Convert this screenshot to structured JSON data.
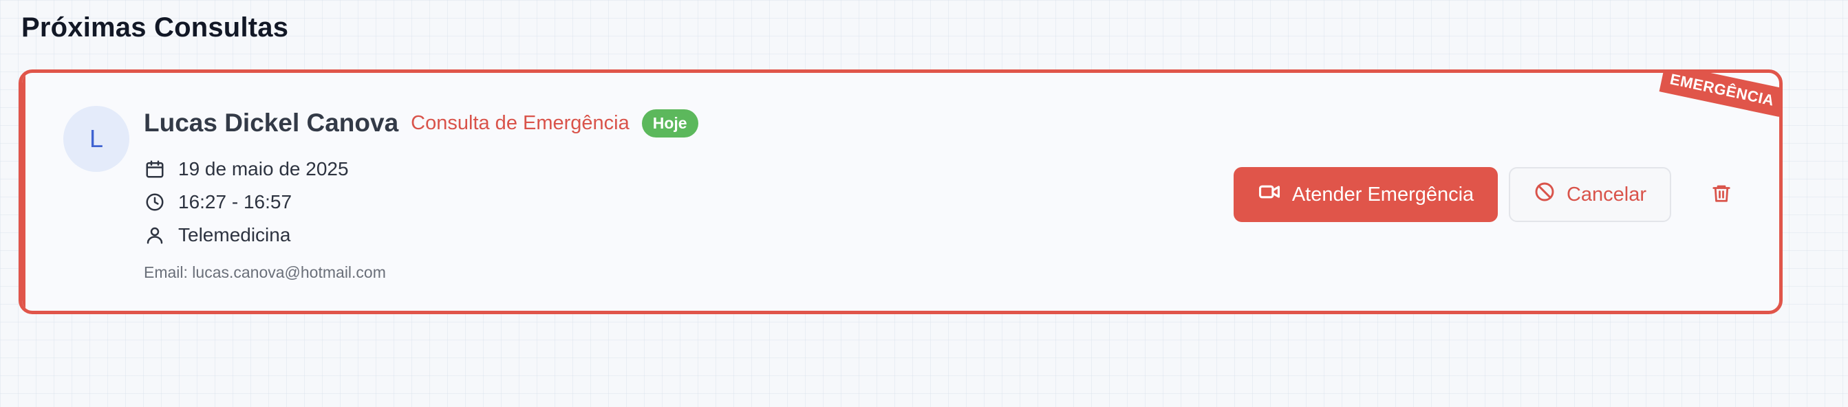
{
  "section": {
    "title": "Próximas Consultas"
  },
  "appointment": {
    "ribbon_label": "EMERGÊNCIA",
    "avatar_initial": "L",
    "patient_name": "Lucas Dickel Canova",
    "consult_type": "Consulta de Emergência",
    "badge": "Hoje",
    "date": "19 de maio de 2025",
    "time": "16:27 - 16:57",
    "mode": "Telemedicina",
    "email": "Email: lucas.canova@hotmail.com",
    "actions": {
      "attend_label": "Atender Emergência",
      "cancel_label": "Cancelar"
    },
    "icons": {
      "date": "calendar-icon",
      "time": "clock-icon",
      "mode": "user-icon",
      "attend": "video-camera-icon",
      "cancel": "ban-icon",
      "delete": "trash-icon"
    }
  },
  "colors": {
    "emergency": "#e0554a",
    "today_badge": "#5cb85c",
    "avatar_bg": "#e4ebfa",
    "avatar_text": "#3f63d1"
  }
}
